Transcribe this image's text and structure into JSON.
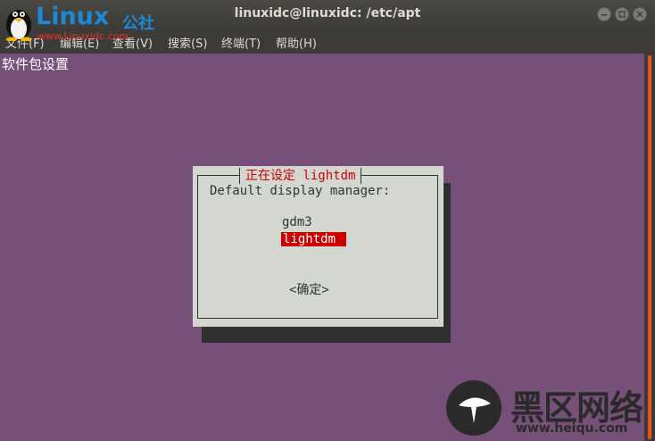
{
  "window": {
    "title": "linuxidc@linuxidc: /etc/apt",
    "controls": [
      "minimize",
      "maximize",
      "close"
    ]
  },
  "logo": {
    "text": "Linux",
    "cn_text": "公社",
    "url": "www.Linuxidc.com"
  },
  "menubar": {
    "items": [
      {
        "label": "文件(F)"
      },
      {
        "label": "编辑(E)"
      },
      {
        "label": "查看(V)"
      },
      {
        "label": "搜索(S)"
      },
      {
        "label": "终端(T)"
      },
      {
        "label": "帮助(H)"
      }
    ]
  },
  "terminal": {
    "header": "软件包设置",
    "dialog": {
      "title": "正在设定 lightdm",
      "prompt": "Default display manager:",
      "options": [
        "gdm3",
        "lightdm"
      ],
      "selected": "lightdm",
      "ok_label": "<确定>"
    }
  },
  "watermark": {
    "cn": "黑区网络",
    "url": "www.heiqu.com"
  },
  "colors": {
    "terminal_bg": "#77507a",
    "dialog_bg": "#d3d7cf",
    "highlight": "#cc0000",
    "titlebar": "#3c3b37",
    "scroll_accent": "#e95420"
  }
}
